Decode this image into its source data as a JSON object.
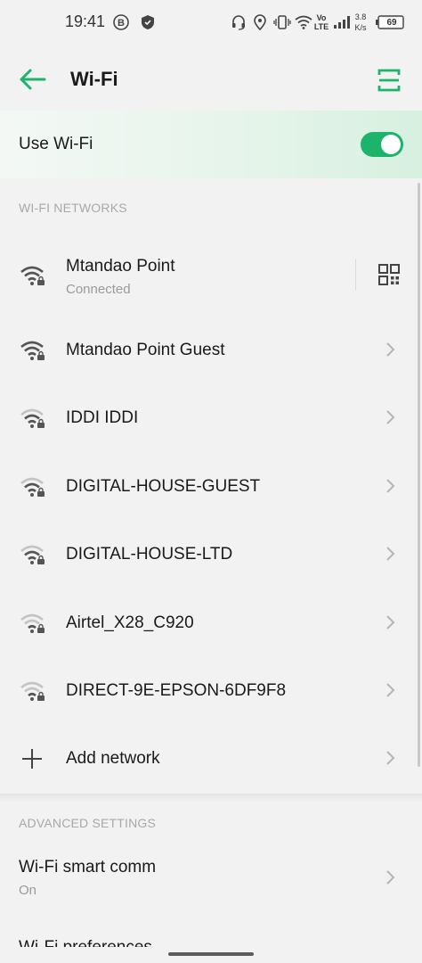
{
  "status_bar": {
    "time": "19:41",
    "network_type_top": "Vo",
    "network_type_bottom": "LTE",
    "speed_value": "3.8",
    "speed_unit": "K/s",
    "battery": "69"
  },
  "header": {
    "title": "Wi-Fi"
  },
  "use_wifi": {
    "label": "Use Wi-Fi",
    "enabled": true
  },
  "networks_section": {
    "heading": "WI-FI NETWORKS",
    "networks": [
      {
        "name": "Mtandao Point",
        "status": "Connected",
        "signal": "strong"
      },
      {
        "name": "Mtandao Point Guest",
        "signal": "strong"
      },
      {
        "name": "IDDI IDDI",
        "signal": "medium"
      },
      {
        "name": "DIGITAL-HOUSE-GUEST",
        "signal": "medium"
      },
      {
        "name": "DIGITAL-HOUSE-LTD",
        "signal": "medium"
      },
      {
        "name": "Airtel_X28_C920",
        "signal": "weak"
      },
      {
        "name": "DIRECT-9E-EPSON-6DF9F8",
        "signal": "weak"
      }
    ],
    "add_network_label": "Add network"
  },
  "advanced_section": {
    "heading": "ADVANCED SETTINGS",
    "items": [
      {
        "title": "Wi-Fi smart comm",
        "subtitle": "On"
      },
      {
        "title": "Wi-Fi preferences"
      }
    ]
  },
  "colors": {
    "accent": "#1cb46a",
    "background": "#f2f2f2",
    "secondary_text": "#9a9a9a"
  }
}
